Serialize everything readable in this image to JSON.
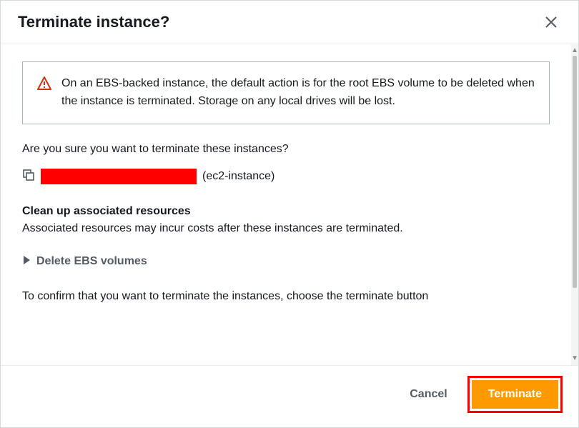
{
  "header": {
    "title": "Terminate instance?"
  },
  "alert": {
    "text": "On an EBS-backed instance, the default action is for the root EBS volume to be deleted when the instance is terminated. Storage on any local drives will be lost."
  },
  "question": "Are you sure you want to terminate these instances?",
  "instance": {
    "name": "(ec2-instance)"
  },
  "cleanup": {
    "heading": "Clean up associated resources",
    "desc": "Associated resources may incur costs after these instances are terminated."
  },
  "expander": {
    "label": "Delete EBS volumes"
  },
  "confirm_text": "To confirm that you want to terminate the instances, choose the terminate button",
  "footer": {
    "cancel_label": "Cancel",
    "terminate_label": "Terminate"
  }
}
